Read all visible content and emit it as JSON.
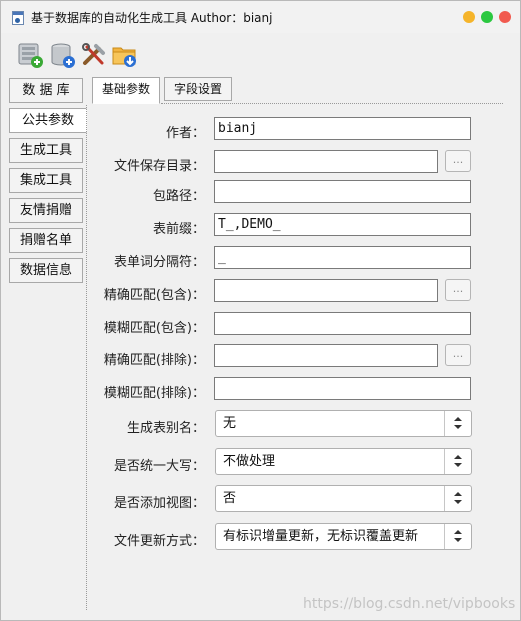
{
  "window": {
    "title": "基于数据库的自动化生成工具  Author：bianj",
    "app_icon": "app-window-icon",
    "controls": [
      "minimize",
      "maximize",
      "close"
    ]
  },
  "toolbar": {
    "buttons": [
      {
        "icon": "add-table-icon"
      },
      {
        "icon": "add-database-icon"
      },
      {
        "icon": "tools-icon"
      },
      {
        "icon": "folder-download-icon"
      }
    ]
  },
  "sidebar": {
    "items": [
      {
        "label": "数 据 库"
      },
      {
        "label": "公共参数",
        "active": true
      },
      {
        "label": "生成工具"
      },
      {
        "label": "集成工具"
      },
      {
        "label": "友情捐赠"
      },
      {
        "label": "捐赠名单"
      },
      {
        "label": "数据信息"
      }
    ]
  },
  "tabs": [
    {
      "label": "基础参数",
      "active": true
    },
    {
      "label": "字段设置"
    }
  ],
  "form": {
    "author": {
      "label": "作者：",
      "value": "bianj"
    },
    "save_dir": {
      "label": "文件保存目录：",
      "value": "",
      "browse": "..."
    },
    "package_path": {
      "label": "包路径：",
      "value": ""
    },
    "table_prefix": {
      "label": "表前缀：",
      "value": "T_,DEMO_"
    },
    "word_sep": {
      "label": "表单词分隔符：",
      "value": "_"
    },
    "exact_include": {
      "label": "精确匹配(包含)：",
      "value": "",
      "browse": "..."
    },
    "fuzzy_include": {
      "label": "模糊匹配(包含)：",
      "value": ""
    },
    "exact_exclude": {
      "label": "精确匹配(排除)：",
      "value": "",
      "browse": "..."
    },
    "fuzzy_exclude": {
      "label": "模糊匹配(排除)：",
      "value": ""
    },
    "table_alias": {
      "label": "生成表别名：",
      "value": "无"
    },
    "uppercase": {
      "label": "是否统一大写：",
      "value": "不做处理"
    },
    "add_view": {
      "label": "是否添加视图：",
      "value": "否"
    },
    "update_mode": {
      "label": "文件更新方式：",
      "value": "有标识增量更新，无标识覆盖更新"
    }
  },
  "watermark": "https://blog.csdn.net/vipbooks"
}
